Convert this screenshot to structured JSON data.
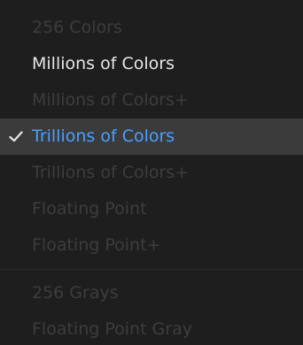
{
  "menu": {
    "items": [
      {
        "label": "256 Colors",
        "state": "disabled"
      },
      {
        "label": "Millions of Colors",
        "state": "enabled"
      },
      {
        "label": "Millions of Colors+",
        "state": "disabled"
      },
      {
        "label": "Trillions of Colors",
        "state": "selected",
        "checked": true
      },
      {
        "label": "Trillions of Colors+",
        "state": "disabled"
      },
      {
        "label": "Floating Point",
        "state": "disabled"
      },
      {
        "label": "Floating Point+",
        "state": "disabled"
      },
      {
        "label": "256 Grays",
        "state": "disabled"
      },
      {
        "label": "Floating Point Gray",
        "state": "disabled"
      }
    ],
    "check_icon": "checkmark-icon",
    "colors": {
      "background": "#1e1e1e",
      "selected_background": "#3b3b3b",
      "selected_text": "#4a9fff",
      "enabled_text": "#e6e6e6",
      "disabled_text": "#3d3d3d"
    }
  }
}
